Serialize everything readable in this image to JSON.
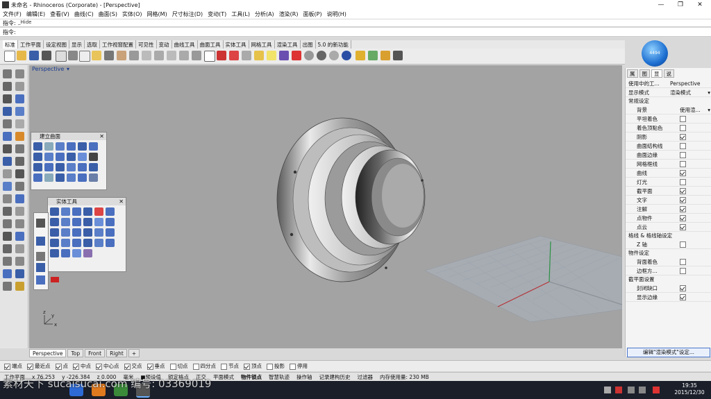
{
  "window": {
    "title": "未命名 - Rhinoceros (Corporate) - [Perspective]",
    "controls": [
      "—",
      "❐",
      "✕"
    ]
  },
  "menu": [
    "文件(F)",
    "编辑(E)",
    "查看(V)",
    "曲线(C)",
    "曲面(S)",
    "实体(O)",
    "网格(M)",
    "尺寸标注(D)",
    "变动(T)",
    "工具(L)",
    "分析(A)",
    "渲染(R)",
    "面板(P)",
    "说明(H)"
  ],
  "command": {
    "history_label": "指令:",
    "history_value": "_Hide",
    "prompt_label": "指令:",
    "prompt_value": ""
  },
  "tabs": [
    "标准",
    "工作平面",
    "设定视图",
    "显示",
    "选取",
    "工作视窗配置",
    "可见性",
    "变动",
    "曲线工具",
    "曲面工具",
    "实体工具",
    "网格工具",
    "渲染工具",
    "出图",
    "5.0 的新功能"
  ],
  "logo_text": "4494",
  "viewport": {
    "title": "Perspective",
    "axis_labels": [
      "z",
      "y",
      "x"
    ]
  },
  "panel_surface": {
    "title": "建立曲面"
  },
  "panel_solid": {
    "title": "实体工具"
  },
  "properties": {
    "tabs": [
      "属",
      "图",
      "显",
      "说"
    ],
    "rows_top": [
      {
        "k": "使用中的工...",
        "v": "Perspective"
      },
      {
        "k": "显示模式",
        "v": "渲染模式"
      }
    ],
    "section1": "常规设定",
    "background": {
      "k": "背景",
      "v": "使用渲..."
    },
    "checks1": [
      {
        "k": "平坦着色",
        "on": false
      },
      {
        "k": "着色顶點色",
        "on": false
      },
      {
        "k": "阴影",
        "on": true
      },
      {
        "k": "曲面结构线",
        "on": false
      },
      {
        "k": "曲面边缘",
        "on": false
      },
      {
        "k": "网格框线",
        "on": false
      },
      {
        "k": "曲线",
        "on": true
      },
      {
        "k": "灯光",
        "on": false
      },
      {
        "k": "截平面",
        "on": true
      },
      {
        "k": "文字",
        "on": true
      },
      {
        "k": "注解",
        "on": true
      },
      {
        "k": "点物件",
        "on": true
      },
      {
        "k": "点云",
        "on": true
      }
    ],
    "section2": "格线 & 格线轴设定",
    "checks2": [
      {
        "k": "Z 轴",
        "on": false
      }
    ],
    "section3": "物件设定",
    "checks3": [
      {
        "k": "背面着色",
        "on": false
      },
      {
        "k": "边框方...",
        "on": false
      }
    ],
    "section4": "截平面设置",
    "checks4": [
      {
        "k": "封闭缺口",
        "on": true
      },
      {
        "k": "显示边缘",
        "on": true
      }
    ],
    "edit_button": "编辑\"渲染模式\"设定..."
  },
  "view_tabs": [
    "Perspective",
    "Top",
    "Front",
    "Right",
    "+"
  ],
  "osnaps": [
    {
      "k": "端点",
      "on": true
    },
    {
      "k": "最近点",
      "on": true
    },
    {
      "k": "点",
      "on": true
    },
    {
      "k": "中点",
      "on": true
    },
    {
      "k": "中心点",
      "on": true
    },
    {
      "k": "交点",
      "on": true
    },
    {
      "k": "垂点",
      "on": true
    },
    {
      "k": "切点",
      "on": false
    },
    {
      "k": "四分点",
      "on": false
    },
    {
      "k": "节点",
      "on": false
    },
    {
      "k": "顶点",
      "on": true
    },
    {
      "k": "投影",
      "on": false
    },
    {
      "k": "停用",
      "on": false
    }
  ],
  "status": [
    "工作平面",
    "x 76.253",
    "y -226.384",
    "z 0.000",
    "毫米",
    "■预设值",
    "锁定格点",
    "正交",
    "平面模式",
    "物件锁点",
    "智慧轨迹",
    "操作轴",
    "记录建构历史",
    "过滤器",
    "内存使用量: 230 MB"
  ],
  "watermark": "素材天下 sucaisucai.com   编号: 03369019",
  "clock": {
    "time": "19:35",
    "date": "2015/12/30"
  },
  "colors": {
    "viewport": "#a3a3a3",
    "accent": "#1d6fd1",
    "grid_x": "#b8262b",
    "grid_y": "#1e8f3a"
  }
}
